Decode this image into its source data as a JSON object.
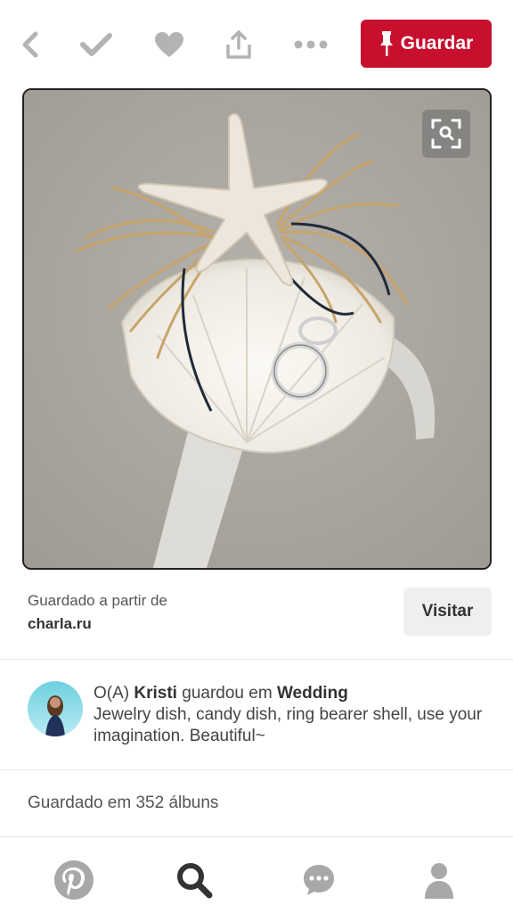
{
  "topbar": {
    "save_label": "Guardar",
    "icons": [
      "chevron-left-icon",
      "check-icon",
      "heart-icon",
      "share-icon",
      "more-icon",
      "pushpin-icon"
    ]
  },
  "pin": {
    "visual_search_icon": "magnifier-scan-icon"
  },
  "source": {
    "label": "Guardado a partir de",
    "domain": "charla.ru",
    "visit_label": "Visitar"
  },
  "activity": {
    "prefix": "O(A) ",
    "user": "Kristi",
    "middle": " guardou em ",
    "board": "Wedding",
    "description": "Jewelry dish, candy dish, ring bearer shell, use your imagination. Beautiful~"
  },
  "saved_count": "Guardado em 352 álbuns",
  "bottom_nav": {
    "icons": [
      "pinterest-logo-icon",
      "search-icon",
      "chat-icon",
      "profile-icon"
    ]
  },
  "colors": {
    "brand": "#c8102e",
    "icon_gray": "#b3b3b3",
    "nav_gray": "#a8a8a8",
    "nav_dark": "#333333"
  }
}
